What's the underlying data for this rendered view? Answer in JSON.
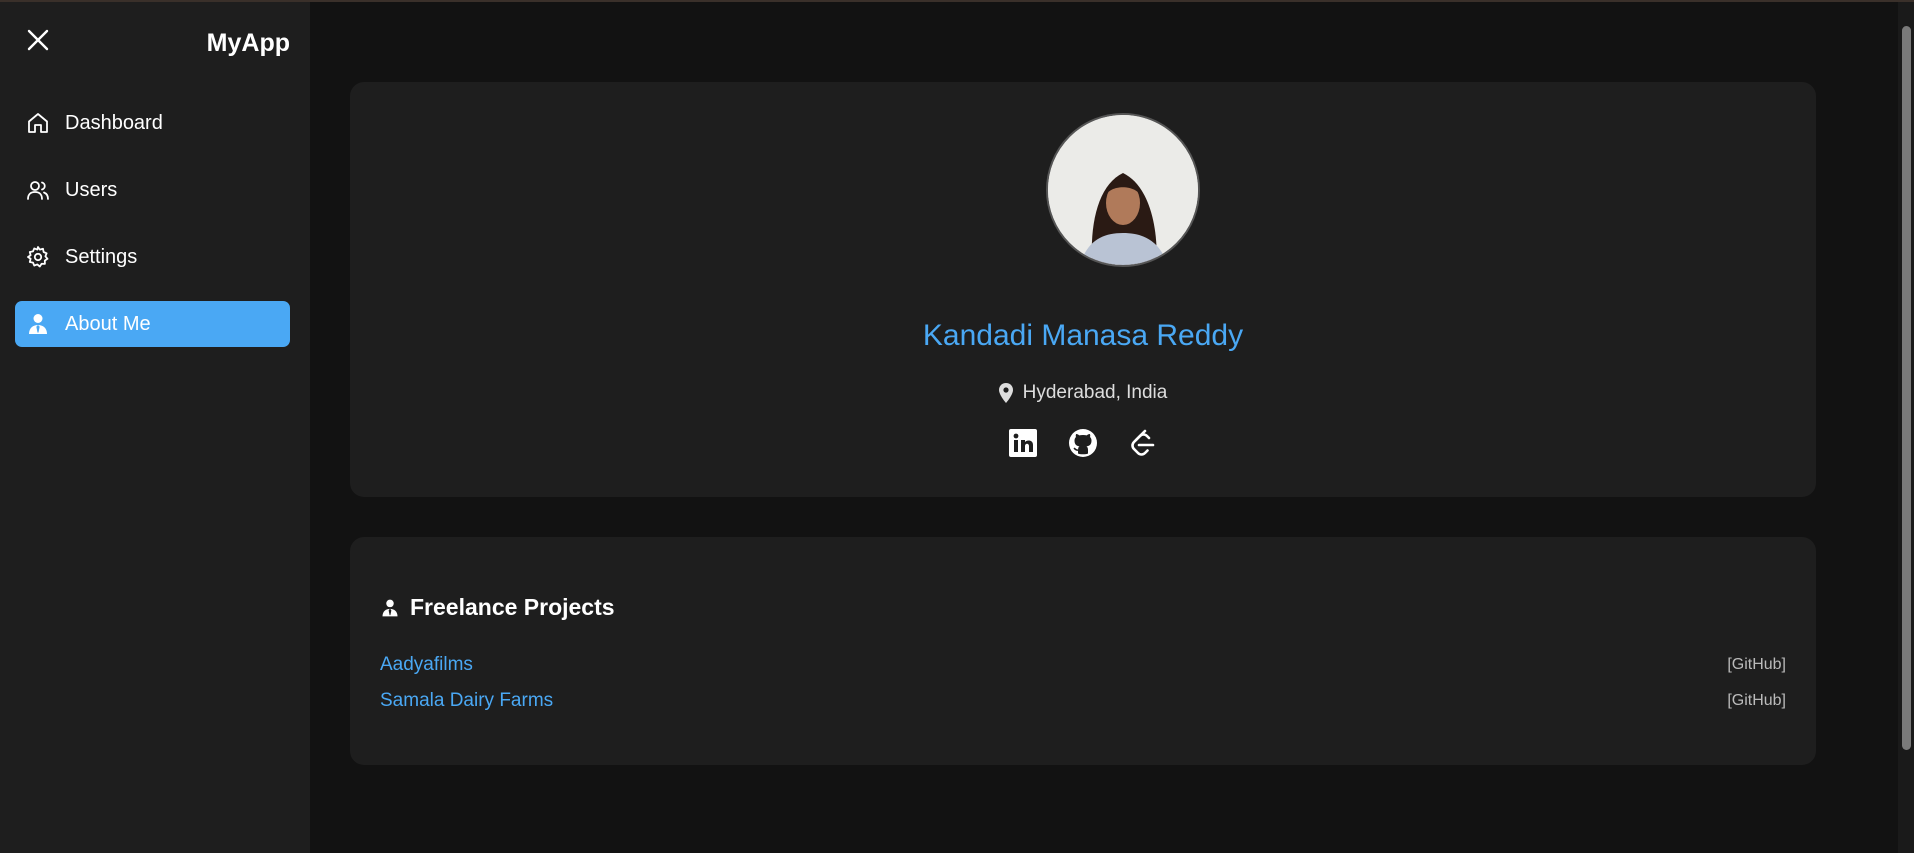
{
  "app": {
    "brand": "MyApp"
  },
  "sidebar": {
    "items": [
      {
        "label": "Dashboard",
        "icon": "home-icon",
        "active": false
      },
      {
        "label": "Users",
        "icon": "users-icon",
        "active": false
      },
      {
        "label": "Settings",
        "icon": "gear-icon",
        "active": false
      },
      {
        "label": "About Me",
        "icon": "user-tie-icon",
        "active": true
      }
    ]
  },
  "profile": {
    "name": "Kandadi Manasa Reddy",
    "location": "Hyderabad, India",
    "socials": [
      "linkedin-icon",
      "github-icon",
      "leetcode-icon"
    ]
  },
  "projects": {
    "title": "Freelance Projects",
    "items": [
      {
        "name": "Aadyafilms",
        "link": "[GitHub]"
      },
      {
        "name": "Samala Dairy Farms",
        "link": "[GitHub]"
      }
    ]
  },
  "colors": {
    "accent": "#4aa8f4",
    "sidebar_bg": "#1e1e1e",
    "page_bg": "#121212",
    "card_bg": "#1e1e1e"
  }
}
